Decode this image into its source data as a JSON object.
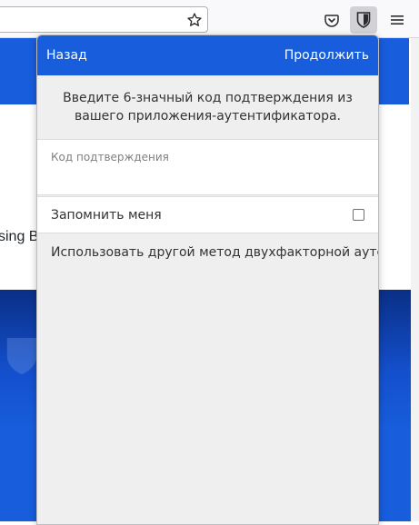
{
  "browser": {
    "url_value": "",
    "icons": {
      "bookmark": "star-icon",
      "pocket": "pocket-icon",
      "extension": "bitwarden-shield-icon",
      "menu": "hamburger-menu-icon"
    }
  },
  "background_page": {
    "snippet": "sing B"
  },
  "popup": {
    "header": {
      "back": "Назад",
      "continue": "Продолжить"
    },
    "instruction": "Введите 6-значный код подтверждения из вашего приложения-аутентификатора.",
    "code_field": {
      "label": "Код подтверждения",
      "value": ""
    },
    "remember_me": {
      "label": "Запомнить меня",
      "checked": false
    },
    "other_method": "Использовать другой метод двухфакторной аутентификации"
  },
  "colors": {
    "brand_blue": "#175ddc",
    "popup_bg": "#efefef",
    "toolbar_bg": "#f9f9fb"
  }
}
